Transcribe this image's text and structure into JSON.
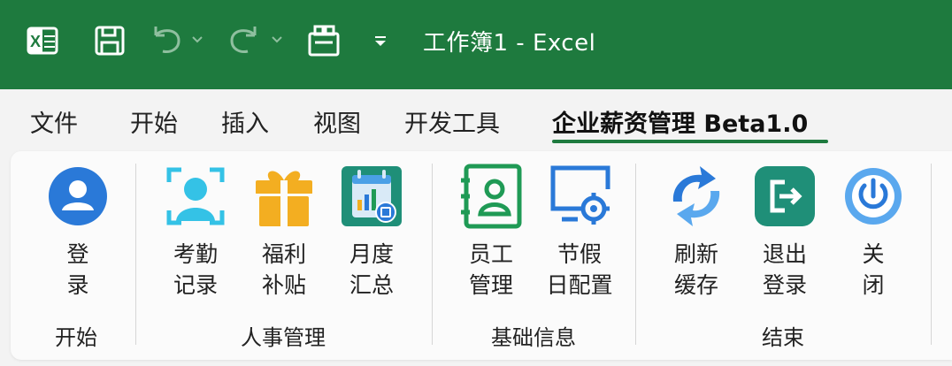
{
  "window": {
    "title": "工作簿1 - Excel",
    "qat_icons": [
      "excel-logo-icon",
      "save-icon",
      "undo-icon",
      "redo-icon",
      "add-in-icon",
      "customize-qat-icon"
    ]
  },
  "menu": {
    "items": [
      "文件",
      "开始",
      "插入",
      "视图",
      "开发工具",
      "企业薪资管理 Beta1.0"
    ],
    "active": "企业薪资管理 Beta1.0"
  },
  "ribbon": {
    "groups": [
      {
        "label": "开始",
        "buttons": [
          {
            "line1": "登",
            "line2": "录",
            "icon": "user-login-icon"
          }
        ]
      },
      {
        "label": "人事管理",
        "buttons": [
          {
            "line1": "考勤",
            "line2": "记录",
            "icon": "face-scan-icon"
          },
          {
            "line1": "福利",
            "line2": "补贴",
            "icon": "gift-icon"
          },
          {
            "line1": "月度",
            "line2": "汇总",
            "icon": "monthly-report-icon"
          }
        ]
      },
      {
        "label": "基础信息",
        "buttons": [
          {
            "line1": "员工",
            "line2": "管理",
            "icon": "contact-book-icon"
          },
          {
            "line1": "节假",
            "line2": "日配置",
            "icon": "monitor-settings-icon"
          }
        ]
      },
      {
        "label": "结束",
        "buttons": [
          {
            "line1": "刷新",
            "line2": "缓存",
            "icon": "refresh-icon"
          },
          {
            "line1": "退出",
            "line2": "登录",
            "icon": "logout-icon"
          },
          {
            "line1": "关",
            "line2": "闭",
            "icon": "power-icon"
          }
        ]
      }
    ]
  },
  "colors": {
    "title_bar": "#1e7a3e",
    "accent_green": "#1f9a55",
    "accent_blue": "#2a79d8",
    "accent_cyan": "#34c2e6",
    "accent_orange": "#f3ae21",
    "accent_teal": "#1f8f78"
  }
}
